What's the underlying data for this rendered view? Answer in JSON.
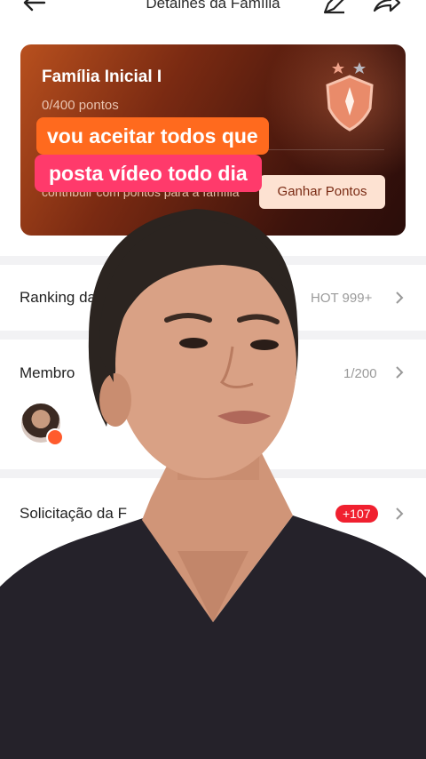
{
  "header": {
    "title": "Detalhes da Família"
  },
  "family_card": {
    "name": "Família Inicial I",
    "points": "0/400 pontos",
    "contribute_text": "contribuir com pontos para a família",
    "earn_button": "Ganhar Pontos"
  },
  "captions": {
    "line1": "vou aceitar todos que",
    "line2": "posta vídeo todo dia"
  },
  "ranking": {
    "label": "Ranking da",
    "value": "HOT 999+"
  },
  "members": {
    "label": "Membro",
    "count": "1/200"
  },
  "requests": {
    "label": "Solicitação da F",
    "badge": "+107"
  },
  "colors": {
    "accent": "#ff6a1e",
    "caption2": "#ff3a6b",
    "badge_red": "#f0202f"
  }
}
